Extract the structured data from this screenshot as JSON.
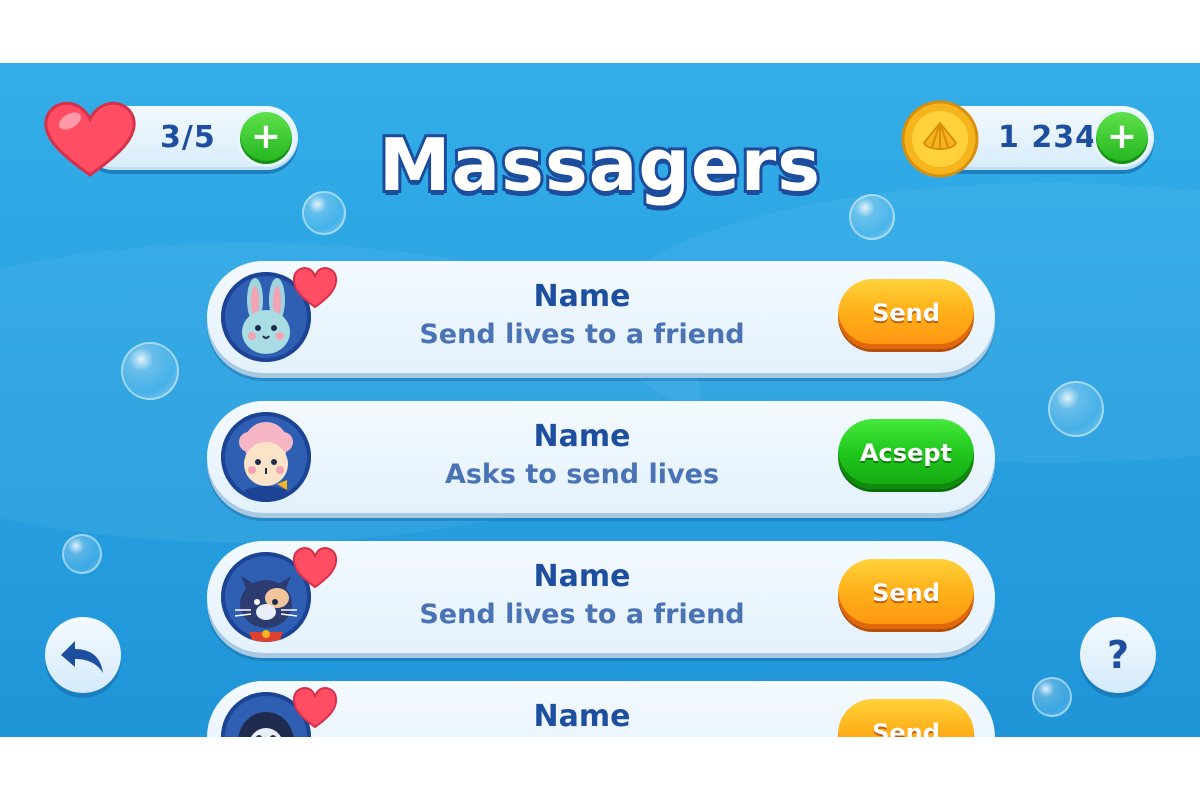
{
  "title": "Massagers",
  "lives": {
    "value": "3/5",
    "plus_label": "+"
  },
  "coins": {
    "value": "1 234",
    "plus_label": "+"
  },
  "messages": [
    {
      "avatar": "rabbit-avatar",
      "name": "Name",
      "text": "Send lives to a friend",
      "has_heart": true,
      "action": "Send",
      "action_color": "#ffa514"
    },
    {
      "avatar": "sheep-avatar",
      "name": "Name",
      "text": "Asks to send lives",
      "has_heart": false,
      "action": "Acsept",
      "action_color": "#22bf1e"
    },
    {
      "avatar": "cat-avatar",
      "name": "Name",
      "text": "Send lives to a friend",
      "has_heart": true,
      "action": "Send",
      "action_color": "#ffa514"
    },
    {
      "avatar": "penguin-avatar",
      "name": "Name",
      "text": "",
      "has_heart": true,
      "action": "Send",
      "action_color": "#ffa514"
    }
  ],
  "back_icon": "back-arrow-icon",
  "help": {
    "label": "?"
  },
  "colors": {
    "background": "#2aa3e2",
    "title_outline": "#1d4c9b",
    "text_primary": "#1e4f9e",
    "text_secondary": "#4a73b5",
    "plus_green": "#22b51f"
  }
}
